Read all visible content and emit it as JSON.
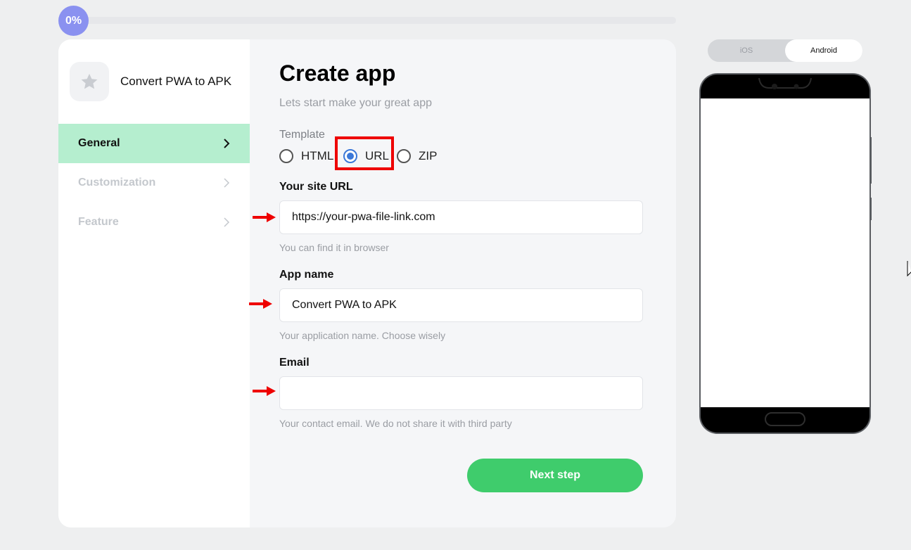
{
  "progress": {
    "label": "0%",
    "value": 0
  },
  "sidebar": {
    "app_title": "Convert PWA to APK",
    "app_icon": "star-icon",
    "items": [
      {
        "label": "General",
        "state": "active"
      },
      {
        "label": "Customization",
        "state": "disabled"
      },
      {
        "label": "Feature",
        "state": "disabled"
      }
    ]
  },
  "form": {
    "title": "Create app",
    "subtitle": "Lets start make your great app",
    "template_label": "Template",
    "template_options": [
      "HTML",
      "URL",
      "ZIP"
    ],
    "template_selected": "URL",
    "site_url": {
      "label": "Your site URL",
      "value": "https://your-pwa-file-link.com",
      "hint": "You can find it in browser"
    },
    "app_name": {
      "label": "App name",
      "value": "Convert PWA to APK",
      "hint": "Your application name. Choose wisely"
    },
    "email": {
      "label": "Email",
      "value": "",
      "hint": "Your contact email. We do not share it with third party"
    },
    "next_label": "Next step"
  },
  "platform": {
    "options": [
      "iOS",
      "Android"
    ],
    "selected": "Android"
  },
  "colors": {
    "accent_green": "#3fcc6c",
    "active_nav": "#b5eecf",
    "progress": "#8a91f0",
    "annotation_red": "#ee0000",
    "radio_blue": "#3b78d8"
  }
}
